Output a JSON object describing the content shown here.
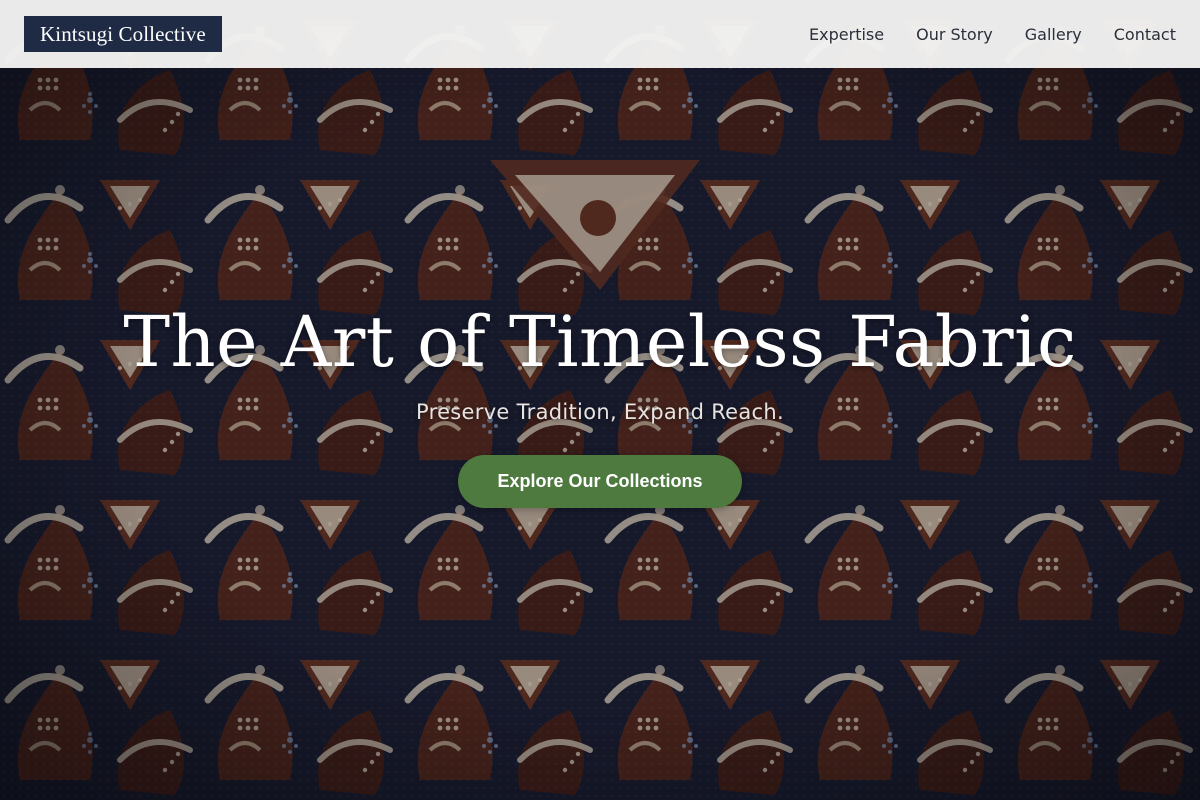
{
  "header": {
    "brand": "Kintsugi Collective",
    "nav": [
      {
        "label": "Expertise"
      },
      {
        "label": "Our Story"
      },
      {
        "label": "Gallery"
      },
      {
        "label": "Contact"
      }
    ]
  },
  "hero": {
    "title": "The Art of Timeless Fabric",
    "subtitle": "Preserve Tradition, Expand Reach.",
    "cta_label": "Explore Our Collections",
    "background": "batik-fabric-pattern"
  },
  "colors": {
    "header_bg": "#f4f4f2",
    "brand_bg": "#1f2b45",
    "cta_bg": "#4e7a40",
    "fabric_indigo": "#1b1f33",
    "fabric_brown": "#5a2a1c",
    "fabric_cream": "#e8dcc6"
  }
}
